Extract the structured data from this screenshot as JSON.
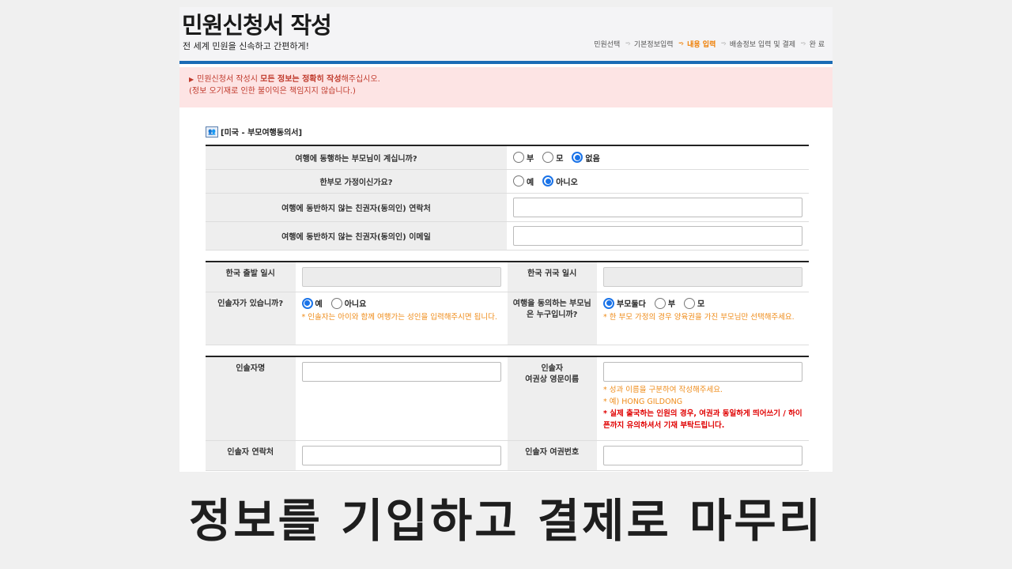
{
  "header": {
    "title": "민원신청서 작성",
    "subtitle": "전 세계 민원을 신속하고 간편하게!",
    "steps": [
      "민원선택",
      "기본정보입력",
      "내용 입력",
      "배송정보 입력 및 결제",
      "완 료"
    ],
    "active_step_index": 2
  },
  "notice": {
    "line1_pre": "민원신청서 작성시 ",
    "line1_bold": "모든 정보는 정확히 작성",
    "line1_post": "해주십시오.",
    "line2": "(정보 오기재로 인한 불이익은 책임지지 않습니다.)"
  },
  "section": {
    "title": "[미국 - 부모여행동의서]",
    "icon": "people-icon"
  },
  "q1": {
    "label": "여행에 동행하는 부모님이 계십니까?",
    "options": [
      "부",
      "모",
      "없음"
    ],
    "selected": "없음"
  },
  "q2": {
    "label": "한부모 가정이신가요?",
    "options": [
      "예",
      "아니오"
    ],
    "selected": "아니오"
  },
  "q3": {
    "label": "여행에 동반하지 않는 친권자(동의인) 연락처",
    "value": ""
  },
  "q4": {
    "label": "여행에 동반하지 않는 친권자(동의인) 이메일",
    "value": ""
  },
  "depart": {
    "label": "한국 출발 일시",
    "value": ""
  },
  "return": {
    "label": "한국 귀국 일시",
    "value": ""
  },
  "escort": {
    "label": "인솔자가 있습니까?",
    "options": [
      "예",
      "아니요"
    ],
    "selected": "예",
    "note": "* 인솔자는 아이와 함께 여행가는 성인을 입력해주시면 됩니다."
  },
  "consent": {
    "label": "여행을 동의하는 부모님은 누구입니까?",
    "options": [
      "부모둘다",
      "부",
      "모"
    ],
    "selected": "부모둘다",
    "note": "* 한 부모 가정의 경우 양육권을 가진 부모님만 선택해주세요."
  },
  "escort_name": {
    "label": "인솔자명",
    "value": ""
  },
  "escort_eng": {
    "label_line1": "인솔자",
    "label_line2": "여권상 영문이름",
    "value": "",
    "note1": "* 성과 이름을 구분하여 작성해주세요.",
    "note2": "* 예) HONG GILDONG",
    "note3": "* 실제 출국하는 인원의 경우, 여권과 동일하게 띄어쓰기 / 하이픈까지 유의하셔서 기재 부탁드립니다."
  },
  "escort_phone": {
    "label": "인솔자 연락처",
    "value": ""
  },
  "escort_passport": {
    "label": "인솔자 여권번호",
    "value": ""
  },
  "caption": "정보를 기입하고 결제로 마무리",
  "colors": {
    "accent": "#1b6bb5",
    "active_step": "#ef7d00",
    "notice_bg": "#fde4e4",
    "note_orange": "#ef8c1a",
    "note_red": "#e00000"
  }
}
